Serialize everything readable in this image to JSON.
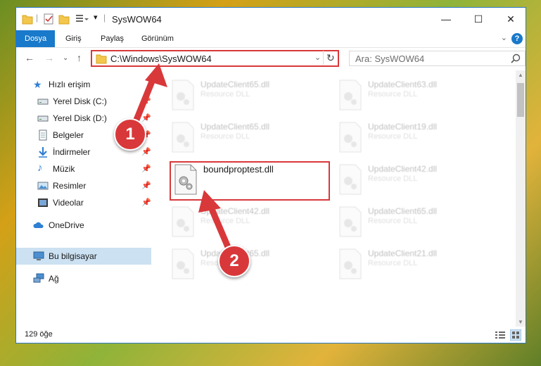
{
  "window": {
    "title": "SysWOW64",
    "controls": {
      "minimize": "—",
      "maximize": "☐",
      "close": "✕"
    }
  },
  "ribbon": {
    "tabs": [
      "Dosya",
      "Giriş",
      "Paylaş",
      "Görünüm"
    ],
    "help": "?"
  },
  "address_bar": {
    "path": "C:\\Windows\\SysWOW64",
    "search_placeholder": "Ara: SysWOW64"
  },
  "nav": {
    "quick_access": "Hızlı erişim",
    "items": [
      {
        "label": "Yerel Disk (C:)",
        "icon": "drive-icon",
        "pinned": true
      },
      {
        "label": "Yerel Disk (D:)",
        "icon": "drive-icon",
        "pinned": true
      },
      {
        "label": "Belgeler",
        "icon": "documents-icon",
        "pinned": true
      },
      {
        "label": "İndirmeler",
        "icon": "downloads-icon",
        "pinned": true
      },
      {
        "label": "Müzik",
        "icon": "music-icon",
        "pinned": true
      },
      {
        "label": "Resimler",
        "icon": "pictures-icon",
        "pinned": true
      },
      {
        "label": "Videolar",
        "icon": "videos-icon",
        "pinned": true
      }
    ],
    "onedrive": "OneDrive",
    "this_pc": "Bu bilgisayar",
    "network": "Ağ"
  },
  "files": {
    "left": [
      {
        "name": "UpdateClient65.dll",
        "desc": "Resource DLL"
      },
      {
        "name": "UpdateClient65.dll",
        "desc": "Resource DLL"
      },
      {
        "name": "boundproptest.dll",
        "desc": ""
      },
      {
        "name": "UpdateClient42.dll",
        "desc": "Resource DLL"
      },
      {
        "name": "UpdateClient65.dll",
        "desc": "Resource DLL"
      }
    ],
    "right": [
      {
        "name": "UpdateClient63.dll",
        "desc": "Resource DLL"
      },
      {
        "name": "UpdateClient19.dll",
        "desc": "Resource DLL"
      },
      {
        "name": "UpdateClient42.dll",
        "desc": "Resource DLL"
      },
      {
        "name": "UpdateClient65.dll",
        "desc": "Resource DLL"
      },
      {
        "name": "UpdateClient21.dll",
        "desc": "Resource DLL"
      }
    ]
  },
  "status": {
    "item_count": "129 öğe"
  },
  "annotations": {
    "step1": "1",
    "step2": "2"
  },
  "colors": {
    "accent": "#1979ca",
    "highlight": "#d9383a"
  }
}
